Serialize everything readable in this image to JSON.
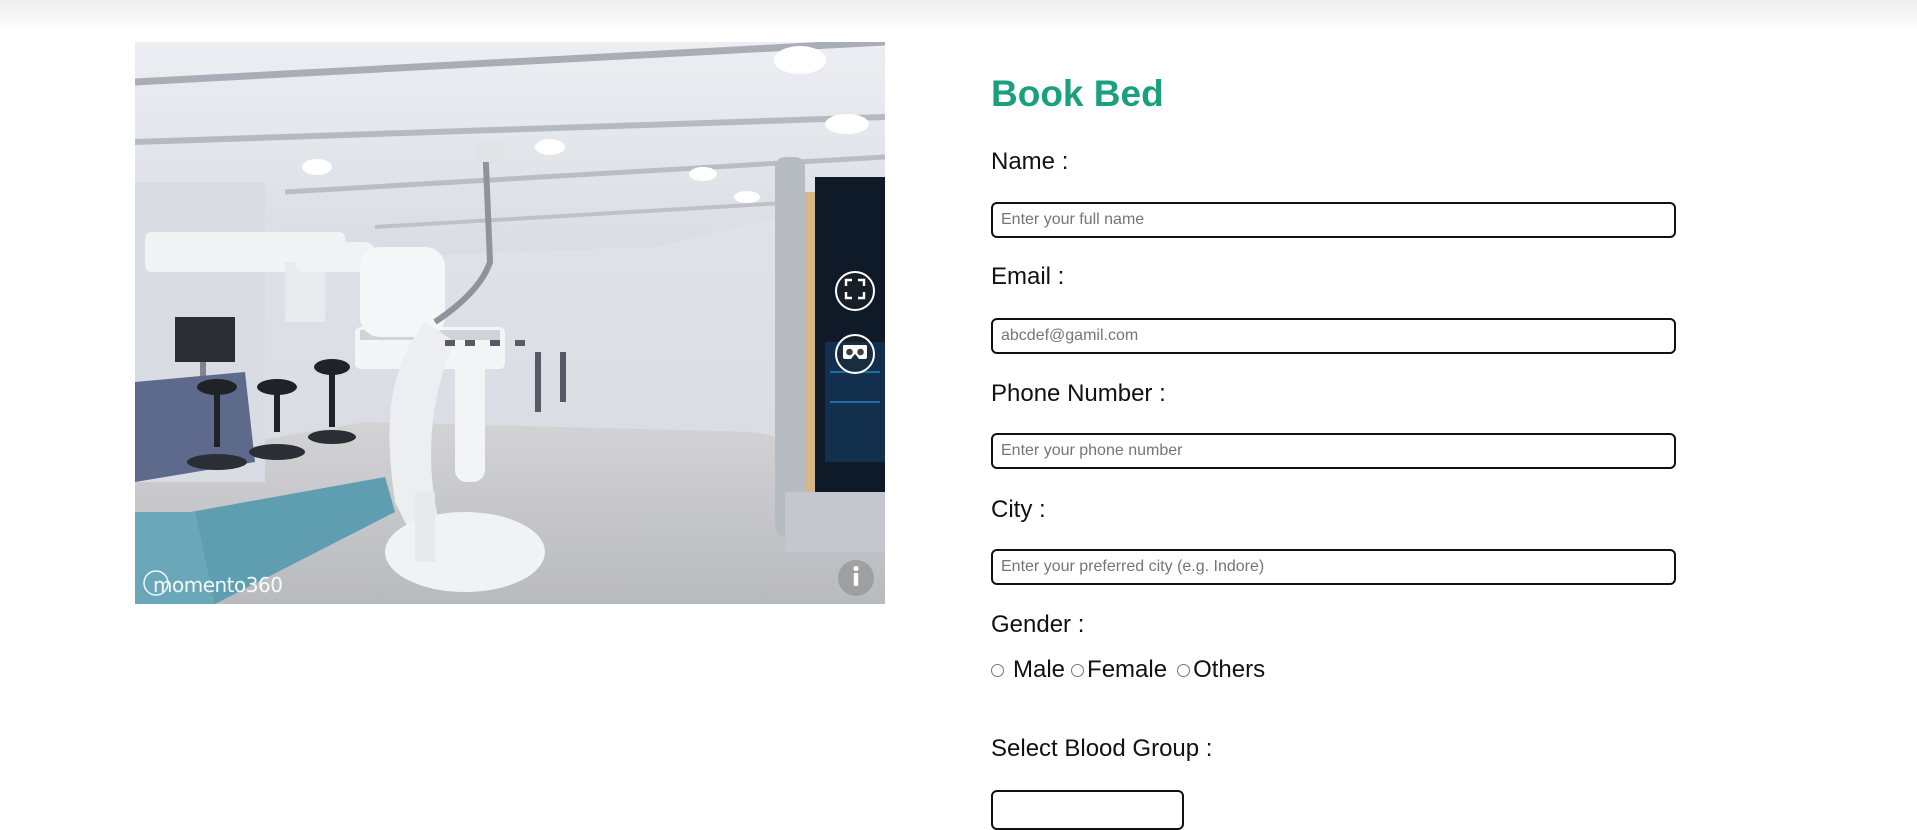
{
  "viewer": {
    "watermark_text": "momento360",
    "fullscreen_icon": "fullscreen-icon",
    "vr_icon": "vr-headset-icon",
    "info_icon": "info-icon"
  },
  "form": {
    "title": "Book Bed",
    "title_color": "#1a9f7f",
    "name_label": "Name :",
    "name_placeholder": "Enter your full name",
    "email_label": "Email :",
    "email_placeholder": "abcdef@gamil.com",
    "phone_label": "Phone Number :",
    "phone_placeholder": "Enter your phone number",
    "city_label": "City :",
    "city_placeholder": "Enter your preferred city (e.g. Indore)",
    "gender_label": "Gender :",
    "gender_options": [
      "Male",
      "Female",
      "Others"
    ],
    "blood_group_label": "Select Blood Group :"
  }
}
